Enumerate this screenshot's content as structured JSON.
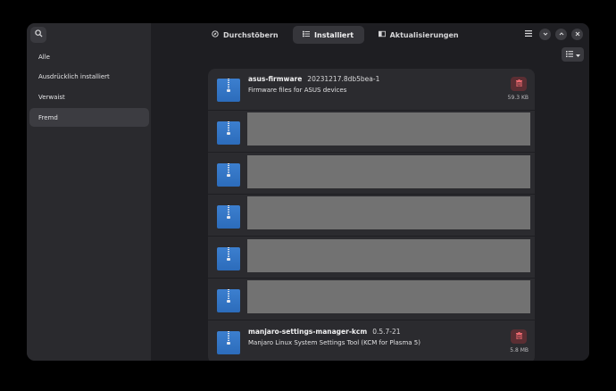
{
  "header": {
    "search_icon": "search-icon",
    "tabs": [
      {
        "label": "Durchstöbern",
        "icon": "explore-icon"
      },
      {
        "label": "Installiert",
        "icon": "list-icon"
      },
      {
        "label": "Aktualisierungen",
        "icon": "update-icon"
      }
    ],
    "menu_icon": "hamburger-menu-icon",
    "window_controls": [
      "minimize-icon",
      "maximize-icon",
      "close-icon"
    ]
  },
  "sidebar": {
    "items": [
      {
        "label": "Alle"
      },
      {
        "label": "Ausdrücklich installiert"
      },
      {
        "label": "Verwaist"
      },
      {
        "label": "Fremd"
      }
    ],
    "active_index": 3
  },
  "view_toggle": {
    "icon": "list-view-icon"
  },
  "packages": [
    {
      "name": "asus-firmware",
      "version": "20231217.8db5bea-1",
      "description": "Firmware files for ASUS devices",
      "size": "59.3 KB",
      "redacted": false
    },
    {
      "redacted": true
    },
    {
      "redacted": true
    },
    {
      "redacted": true
    },
    {
      "redacted": true
    },
    {
      "redacted": true
    },
    {
      "name": "manjaro-settings-manager-kcm",
      "version": "0.5.7-21",
      "description": "Manjaro Linux System Settings Tool (KCM for Plasma 5)",
      "size": "5.8 MB",
      "redacted": false
    }
  ],
  "colors": {
    "accent_danger": "#ec6a70",
    "package_icon": "#2f73c4",
    "redaction": "#727272"
  }
}
